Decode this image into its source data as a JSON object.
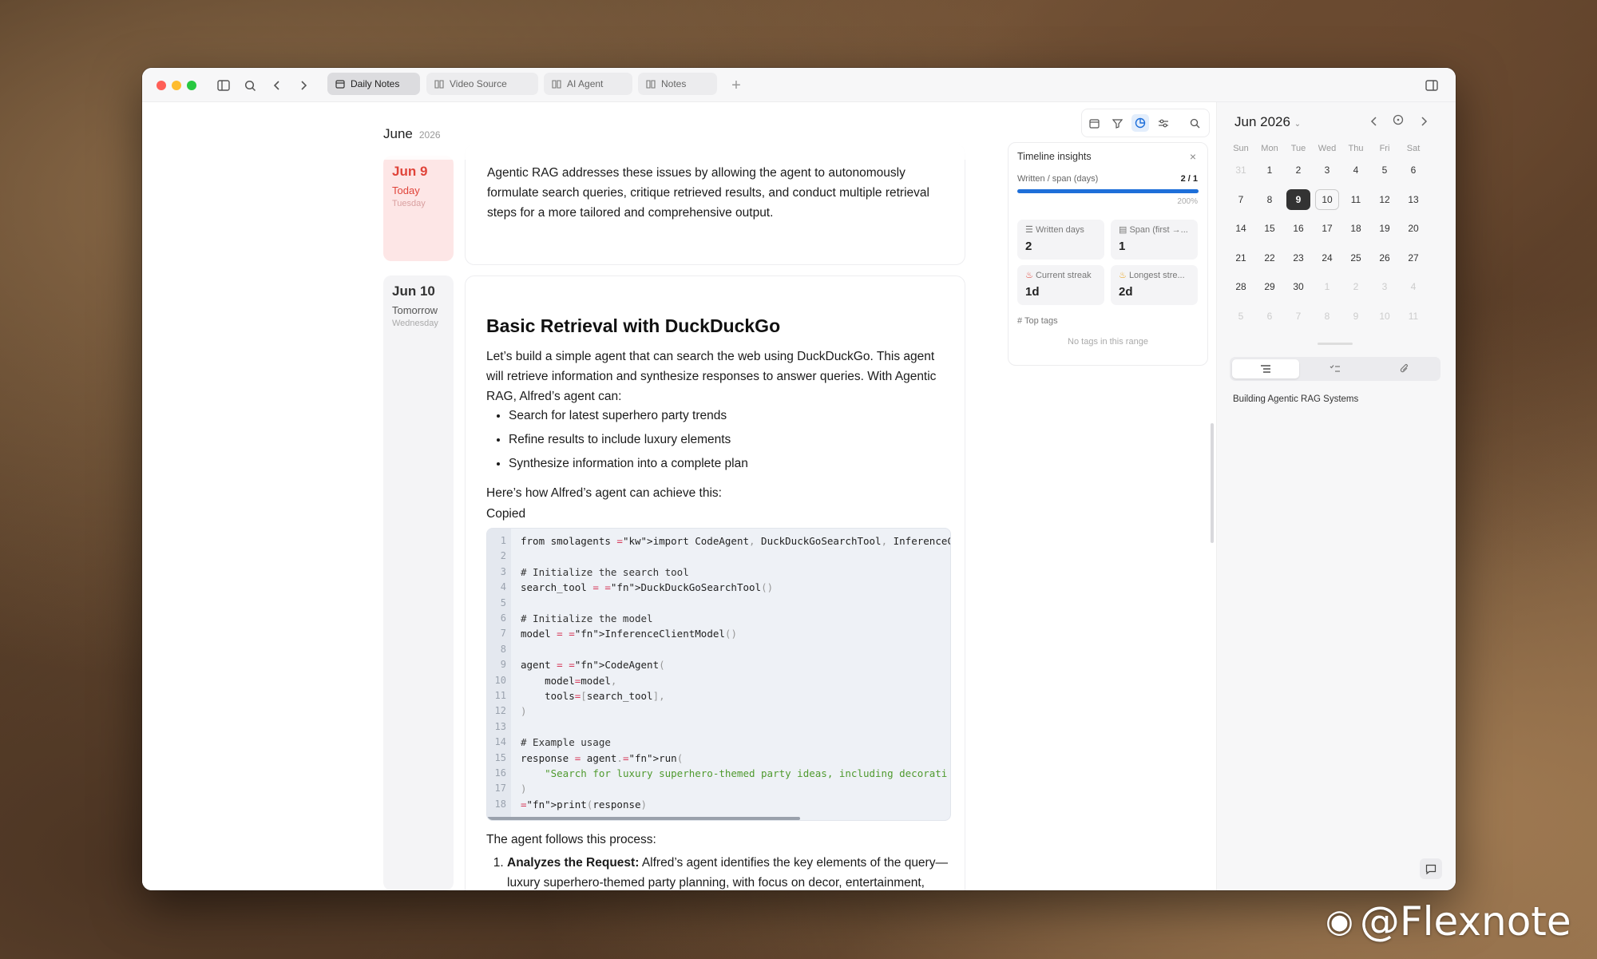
{
  "titlebar": {
    "tabs": [
      {
        "label": "Daily Notes",
        "icon": "calendar-icon",
        "active": true
      },
      {
        "label": "Video Source",
        "icon": "book-icon",
        "active": false
      },
      {
        "label": "AI Agent",
        "icon": "book-icon",
        "active": false
      },
      {
        "label": "Notes",
        "icon": "book-icon",
        "active": false
      }
    ],
    "new_tab": "+"
  },
  "timeline": {
    "month": "June",
    "year": "2026",
    "days": [
      {
        "date": "Jun 9",
        "relative": "Today",
        "weekday": "Tuesday"
      },
      {
        "date": "Jun 10",
        "relative": "Tomorrow",
        "weekday": "Wednesday"
      }
    ]
  },
  "note_top": {
    "paragraph": "Agentic RAG addresses these issues by allowing the agent to autonomously formulate search queries, critique retrieved results, and conduct multiple retrieval steps for a more tailored and comprehensive output."
  },
  "note_main": {
    "heading": "Basic Retrieval with DuckDuckGo",
    "intro": "Let’s build a simple agent that can search the web using DuckDuckGo. This agent will retrieve information and synthesize responses to answer queries. With Agentic RAG, Alfred’s agent can:",
    "bullets": [
      "Search for latest superhero party trends",
      "Refine results to include luxury elements",
      "Synthesize information into a complete plan"
    ],
    "lead": "Here’s how Alfred’s agent can achieve this:",
    "copied": "Copied",
    "code_lines": [
      "from smolagents import CodeAgent, DuckDuckGoSearchTool, InferenceClient",
      "",
      "# Initialize the search tool",
      "search_tool = DuckDuckGoSearchTool()",
      "",
      "# Initialize the model",
      "model = InferenceClientModel()",
      "",
      "agent = CodeAgent(",
      "    model=model,",
      "    tools=[search_tool],",
      ")",
      "",
      "# Example usage",
      "response = agent.run(",
      "    \"Search for luxury superhero-themed party ideas, including decorati",
      ")",
      "print(response)"
    ],
    "process_lead": "The agent follows this process:",
    "step1_label": "Analyzes the Request:",
    "step1_text": "Alfred’s agent identifies the key elements of the query—luxury superhero-themed party planning, with focus on decor, entertainment,"
  },
  "insights": {
    "title": "Timeline insights",
    "ratio_label": "Written / span (days)",
    "ratio_value": "2 / 1",
    "percent": "200%",
    "progress_fraction": 1.0,
    "written_days_label": "Written days",
    "written_days": "2",
    "span_label": "Span (first →...",
    "span": "1",
    "current_streak_label": "Current streak",
    "current_streak": "1d",
    "longest_streak_label": "Longest stre...",
    "longest_streak": "2d",
    "top_tags_label": "Top tags",
    "no_tags": "No tags in this range"
  },
  "calendar": {
    "title": "Jun 2026",
    "weekdays": [
      "Sun",
      "Mon",
      "Tue",
      "Wed",
      "Thu",
      "Fri",
      "Sat"
    ],
    "weeks": [
      [
        "31",
        "1",
        "2",
        "3",
        "4",
        "5",
        "6"
      ],
      [
        "7",
        "8",
        "9",
        "10",
        "11",
        "12",
        "13"
      ],
      [
        "14",
        "15",
        "16",
        "17",
        "18",
        "19",
        "20"
      ],
      [
        "21",
        "22",
        "23",
        "24",
        "25",
        "26",
        "27"
      ],
      [
        "28",
        "29",
        "30",
        "1",
        "2",
        "3",
        "4"
      ],
      [
        "5",
        "6",
        "7",
        "8",
        "9",
        "10",
        "11"
      ]
    ],
    "selected": "9",
    "today_ring": "10"
  },
  "outline": {
    "item": "Building Agentic RAG Systems"
  },
  "watermark": "@Flexnote",
  "colors": {
    "today_accent": "#e0443a",
    "today_bg": "#fde6e6",
    "progress": "#1e6fd9",
    "active_tool": "#1e6fd9"
  }
}
